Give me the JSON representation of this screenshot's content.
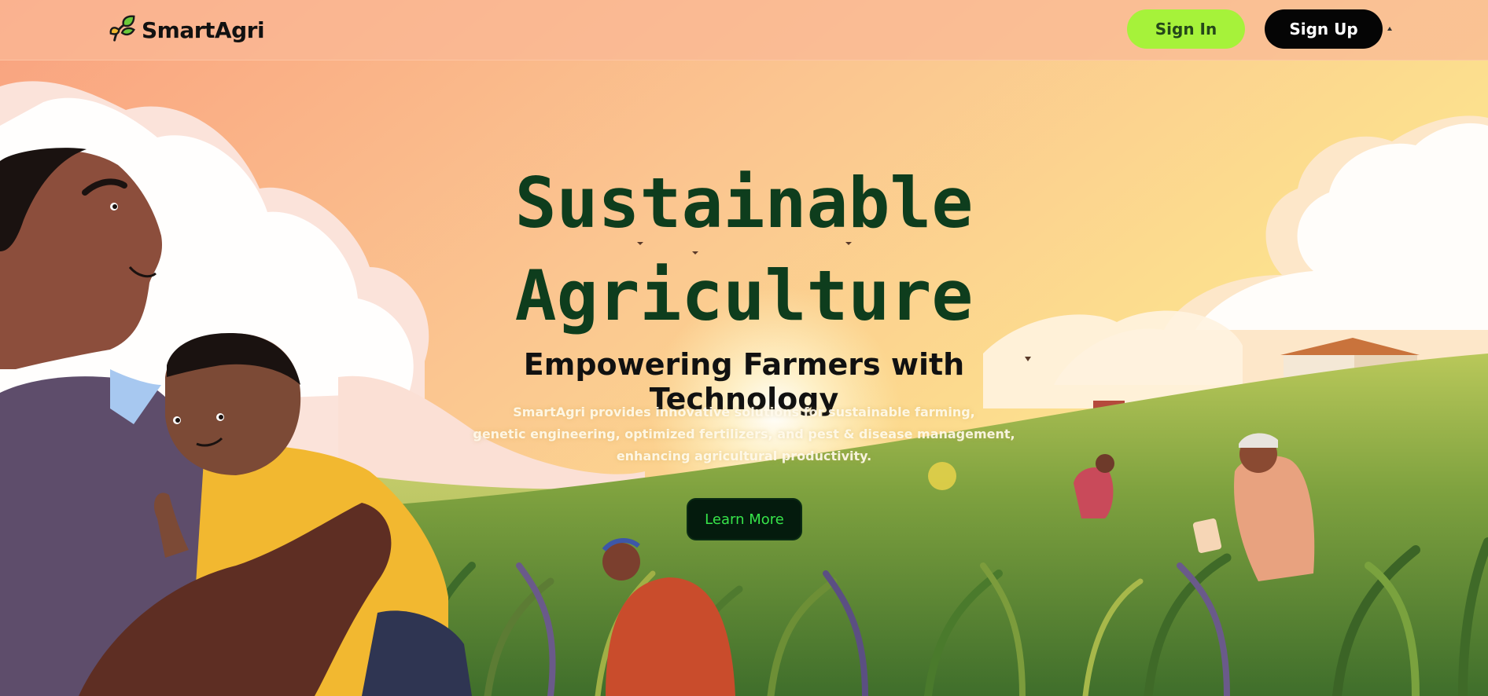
{
  "app": {
    "title": "SmartAgri"
  },
  "navbar": {
    "brand_name": "SmartAgri",
    "sign_in_label": "Sign In",
    "sign_up_label": "Sign Up"
  },
  "hero": {
    "title_line1": "Sustainable",
    "title_line2": "Agriculture",
    "subtitle": "Empowering Farmers with Technology",
    "description_line1": "SmartAgri provides innovative solutions for sustainable farming,",
    "description_line2": "genetic engineering, optimized fertilizers, and pest & disease management,",
    "description_line3": "enhancing agricultural productivity.",
    "cta_label": "Learn More"
  },
  "icons": {
    "logo": "sprout-icon",
    "caret": "caret-up-icon"
  },
  "colors": {
    "accent_green": "#a6f23a",
    "title_green": "#0e3d1d",
    "cta_text": "#37e44a",
    "dark": "#050505"
  }
}
